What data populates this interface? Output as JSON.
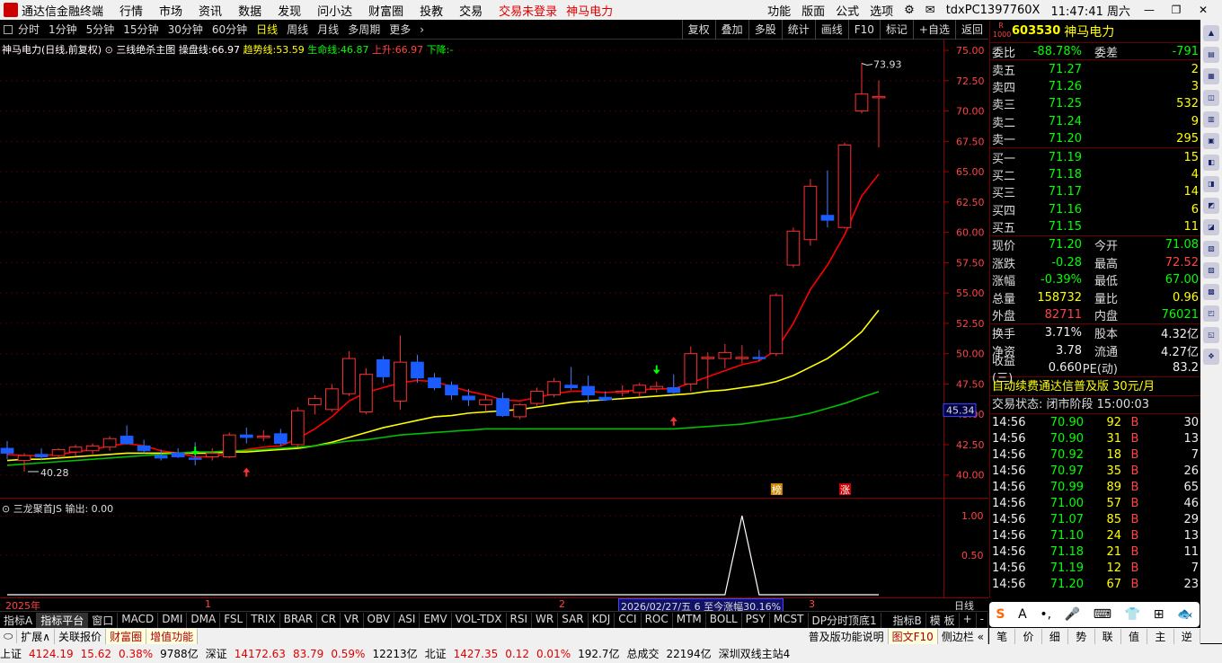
{
  "menubar": {
    "app_title": "通达信金融终端",
    "items": [
      "行情",
      "市场",
      "资讯",
      "数据",
      "发现",
      "问小达",
      "财富圈",
      "投教",
      "交易"
    ],
    "trade_status": "交易未登录",
    "stock_name": "神马电力",
    "right_items": [
      "功能",
      "版面",
      "公式",
      "选项"
    ],
    "machine": "tdxPC1397760X",
    "clock": "11:47:41 周六"
  },
  "periodbar": {
    "items": [
      "分时",
      "1分钟",
      "5分钟",
      "15分钟",
      "30分钟",
      "60分钟",
      "日线",
      "周线",
      "月线",
      "多周期",
      "更多"
    ],
    "active": "日线",
    "tools": [
      "复权",
      "叠加",
      "多股",
      "统计",
      "画线",
      "F10",
      "标记",
      "+自选",
      "返回"
    ]
  },
  "indicator_line": {
    "stock": "神马电力",
    "mode": "(日线,前复权)",
    "name": "三线绝杀主图",
    "cp_label": "操盘线:",
    "cp_value": "66.97",
    "qs_label": "趋势线:",
    "qs_value": "53.59",
    "sm_label": "生命线:",
    "sm_value": "46.87",
    "up_label": "上升:",
    "up_value": "66.97",
    "down_label": "下降:",
    "down_value": "-"
  },
  "sub_indicator": {
    "name": "三龙聚首JS",
    "out_label": "输出:",
    "out_value": "0.00"
  },
  "chart_data": {
    "type": "candlestick",
    "price_axis_ticks": [
      75.0,
      72.5,
      70.0,
      67.5,
      65.0,
      62.5,
      60.0,
      57.5,
      55.0,
      52.5,
      50.0,
      47.5,
      45.0,
      42.5,
      40.0
    ],
    "ylim": [
      38.5,
      75.3
    ],
    "current_price_label": "45.34",
    "high_annotation": "73.93",
    "low_annotation": "40.28",
    "sub_axis_ticks": [
      "1.00",
      "0.50"
    ],
    "time_labels": [
      "2025年",
      "1",
      "2",
      "3"
    ],
    "range_label": "2026/02/27/五 6 至今涨幅30.16%",
    "axis_unit": "日线",
    "tags": [
      "榜",
      "涨"
    ],
    "candles": [
      {
        "o": 42.2,
        "h": 42.8,
        "l": 41.3,
        "c": 41.8
      },
      {
        "o": 41.2,
        "h": 41.8,
        "l": 40.28,
        "c": 41.6
      },
      {
        "o": 41.7,
        "h": 42.2,
        "l": 41.2,
        "c": 41.5
      },
      {
        "o": 41.6,
        "h": 42.2,
        "l": 41.4,
        "c": 42.1
      },
      {
        "o": 41.9,
        "h": 42.5,
        "l": 41.6,
        "c": 42.3
      },
      {
        "o": 42.0,
        "h": 42.6,
        "l": 41.7,
        "c": 42.4
      },
      {
        "o": 42.3,
        "h": 43.2,
        "l": 42.0,
        "c": 43.0
      },
      {
        "o": 43.2,
        "h": 44.1,
        "l": 42.5,
        "c": 42.6
      },
      {
        "o": 42.4,
        "h": 42.9,
        "l": 41.8,
        "c": 42.0
      },
      {
        "o": 41.6,
        "h": 42.1,
        "l": 41.2,
        "c": 41.4
      },
      {
        "o": 41.8,
        "h": 42.2,
        "l": 41.4,
        "c": 41.5
      },
      {
        "o": 41.4,
        "h": 42.7,
        "l": 40.8,
        "c": 41.3
      },
      {
        "o": 41.5,
        "h": 42.2,
        "l": 41.2,
        "c": 41.8
      },
      {
        "o": 41.5,
        "h": 43.5,
        "l": 41.4,
        "c": 43.3
      },
      {
        "o": 43.3,
        "h": 43.9,
        "l": 42.6,
        "c": 43.1
      },
      {
        "o": 43.2,
        "h": 43.7,
        "l": 42.8,
        "c": 43.2
      },
      {
        "o": 43.4,
        "h": 43.8,
        "l": 42.4,
        "c": 42.6
      },
      {
        "o": 42.5,
        "h": 45.6,
        "l": 42.3,
        "c": 45.3
      },
      {
        "o": 45.8,
        "h": 46.6,
        "l": 45.0,
        "c": 46.3
      },
      {
        "o": 45.4,
        "h": 47.5,
        "l": 45.2,
        "c": 47.1
      },
      {
        "o": 46.7,
        "h": 50.2,
        "l": 46.5,
        "c": 49.6
      },
      {
        "o": 45.2,
        "h": 48.8,
        "l": 45.0,
        "c": 48.3
      },
      {
        "o": 49.5,
        "h": 49.8,
        "l": 47.6,
        "c": 48.1
      },
      {
        "o": 46.1,
        "h": 51.5,
        "l": 45.4,
        "c": 49.3
      },
      {
        "o": 49.3,
        "h": 49.9,
        "l": 47.6,
        "c": 48.0
      },
      {
        "o": 48.0,
        "h": 48.4,
        "l": 47.0,
        "c": 47.2
      },
      {
        "o": 47.4,
        "h": 47.7,
        "l": 46.2,
        "c": 46.6
      },
      {
        "o": 46.5,
        "h": 47.1,
        "l": 45.7,
        "c": 46.2
      },
      {
        "o": 45.8,
        "h": 46.6,
        "l": 45.3,
        "c": 46.2
      },
      {
        "o": 46.3,
        "h": 46.8,
        "l": 44.8,
        "c": 44.9
      },
      {
        "o": 44.8,
        "h": 45.9,
        "l": 44.6,
        "c": 45.8
      },
      {
        "o": 45.9,
        "h": 47.2,
        "l": 45.7,
        "c": 46.9
      },
      {
        "o": 46.6,
        "h": 48.0,
        "l": 46.4,
        "c": 47.7
      },
      {
        "o": 47.4,
        "h": 48.9,
        "l": 47.0,
        "c": 47.2
      },
      {
        "o": 47.3,
        "h": 48.2,
        "l": 45.9,
        "c": 46.6
      },
      {
        "o": 46.4,
        "h": 46.9,
        "l": 46.1,
        "c": 46.2
      },
      {
        "o": 46.8,
        "h": 47.4,
        "l": 46.5,
        "c": 46.9
      },
      {
        "o": 46.8,
        "h": 47.6,
        "l": 46.4,
        "c": 47.4
      },
      {
        "o": 47.1,
        "h": 47.7,
        "l": 46.8,
        "c": 47.3
      },
      {
        "o": 47.2,
        "h": 48.3,
        "l": 46.7,
        "c": 46.8
      },
      {
        "o": 47.5,
        "h": 50.6,
        "l": 46.9,
        "c": 50.0
      },
      {
        "o": 49.7,
        "h": 50.1,
        "l": 47.1,
        "c": 49.7
      },
      {
        "o": 49.6,
        "h": 50.8,
        "l": 48.8,
        "c": 50.1
      },
      {
        "o": 49.7,
        "h": 50.7,
        "l": 49.2,
        "c": 49.7
      },
      {
        "o": 49.7,
        "h": 50.3,
        "l": 49.4,
        "c": 49.6
      },
      {
        "o": 50.0,
        "h": 55.0,
        "l": 49.8,
        "c": 54.8
      },
      {
        "o": 57.3,
        "h": 60.4,
        "l": 57.1,
        "c": 60.1
      },
      {
        "o": 59.4,
        "h": 64.4,
        "l": 58.9,
        "c": 63.8
      },
      {
        "o": 61.4,
        "h": 65.1,
        "l": 60.4,
        "c": 61.0
      },
      {
        "o": 60.4,
        "h": 67.4,
        "l": 60.3,
        "c": 67.2
      },
      {
        "o": 70.0,
        "h": 73.93,
        "l": 69.8,
        "c": 71.4
      },
      {
        "o": 71.2,
        "h": 72.52,
        "l": 67.0,
        "c": 71.2
      }
    ],
    "series": [
      {
        "name": "操盘线",
        "color": "#ff0000",
        "values": [
          41.7,
          41.6,
          41.6,
          41.7,
          41.9,
          42.1,
          42.4,
          42.6,
          42.4,
          42.0,
          41.8,
          41.5,
          41.5,
          41.8,
          42.1,
          42.3,
          42.4,
          43.0,
          43.8,
          44.8,
          46.1,
          46.8,
          47.2,
          47.6,
          47.8,
          47.7,
          47.3,
          46.9,
          46.6,
          46.2,
          46.1,
          46.4,
          46.7,
          46.9,
          46.9,
          46.8,
          46.9,
          47.0,
          47.1,
          47.1,
          47.6,
          48.1,
          48.6,
          49.1,
          49.4,
          50.3,
          52.5,
          55.3,
          57.3,
          59.8,
          63.0,
          64.8
        ]
      },
      {
        "name": "趋势线",
        "color": "#ffff00",
        "values": [
          41.2,
          41.3,
          41.3,
          41.4,
          41.5,
          41.6,
          41.7,
          41.8,
          41.8,
          41.8,
          41.8,
          41.8,
          41.8,
          41.9,
          41.9,
          42.0,
          42.1,
          42.2,
          42.4,
          42.7,
          43.1,
          43.5,
          43.9,
          44.2,
          44.5,
          44.8,
          44.9,
          45.1,
          45.2,
          45.3,
          45.4,
          45.6,
          45.8,
          46.0,
          46.1,
          46.2,
          46.3,
          46.4,
          46.5,
          46.6,
          46.7,
          46.9,
          47.0,
          47.2,
          47.4,
          47.7,
          48.2,
          48.9,
          49.6,
          50.6,
          51.8,
          53.59
        ]
      },
      {
        "name": "生命线",
        "color": "#00c000",
        "values": [
          40.8,
          40.9,
          41.0,
          41.1,
          41.2,
          41.3,
          41.4,
          41.5,
          41.6,
          41.7,
          41.8,
          41.9,
          41.9,
          42.0,
          42.0,
          42.1,
          42.2,
          42.3,
          42.4,
          42.6,
          42.8,
          42.9,
          43.1,
          43.3,
          43.4,
          43.5,
          43.6,
          43.7,
          43.8,
          43.8,
          43.8,
          43.8,
          43.8,
          43.8,
          43.8,
          43.8,
          43.8,
          43.8,
          43.8,
          43.8,
          43.9,
          44.0,
          44.1,
          44.2,
          44.4,
          44.6,
          44.8,
          45.1,
          45.5,
          45.9,
          46.4,
          46.87
        ]
      }
    ],
    "sub_series": {
      "name": "三龙聚首JS",
      "peak_index": 43,
      "peak_value": 1.0
    }
  },
  "quote": {
    "badge": "R 1000",
    "code": "603530",
    "name": "神马电力",
    "wb_label": "委比",
    "wb_value": "-88.78%",
    "wc_label": "委差",
    "wc_value": "-791",
    "asks": [
      {
        "label": "卖五",
        "price": "71.27",
        "vol": "2"
      },
      {
        "label": "卖四",
        "price": "71.26",
        "vol": "3"
      },
      {
        "label": "卖三",
        "price": "71.25",
        "vol": "532"
      },
      {
        "label": "卖二",
        "price": "71.24",
        "vol": "9"
      },
      {
        "label": "卖一",
        "price": "71.20",
        "vol": "295"
      }
    ],
    "bids": [
      {
        "label": "买一",
        "price": "71.19",
        "vol": "15"
      },
      {
        "label": "买二",
        "price": "71.18",
        "vol": "4"
      },
      {
        "label": "买三",
        "price": "71.17",
        "vol": "14"
      },
      {
        "label": "买四",
        "price": "71.16",
        "vol": "6"
      },
      {
        "label": "买五",
        "price": "71.15",
        "vol": "11"
      }
    ],
    "stats1": [
      {
        "l1": "现价",
        "v1": "71.20",
        "l2": "今开",
        "v2": "71.08",
        "c1": "green",
        "c2": "green"
      },
      {
        "l1": "涨跌",
        "v1": "-0.28",
        "l2": "最高",
        "v2": "72.52",
        "c1": "green",
        "c2": "red"
      },
      {
        "l1": "涨幅",
        "v1": "-0.39%",
        "l2": "最低",
        "v2": "67.00",
        "c1": "green",
        "c2": "green"
      },
      {
        "l1": "总量",
        "v1": "158732",
        "l2": "量比",
        "v2": "0.96",
        "c1": "yellow",
        "c2": "yellow"
      },
      {
        "l1": "外盘",
        "v1": "82711",
        "l2": "内盘",
        "v2": "76021",
        "c1": "red",
        "c2": "green"
      }
    ],
    "stats2": [
      {
        "l1": "换手",
        "v1": "3.71%",
        "l2": "股本",
        "v2": "4.32亿",
        "c1": "white",
        "c2": "white"
      },
      {
        "l1": "净资",
        "v1": "3.78",
        "l2": "流通",
        "v2": "4.27亿",
        "c1": "white",
        "c2": "white"
      },
      {
        "l1": "收益(三)",
        "v1": "0.660",
        "l2": "PE(动)",
        "v2": "83.2",
        "c1": "white",
        "c2": "white"
      }
    ],
    "ad": "自动续费通达信普及版",
    "ad_price": "30元/月",
    "state": "交易状态: 闭市阶段 15:00:03",
    "ticks": [
      {
        "t": "14:56",
        "p": "70.90",
        "v": "92",
        "bs": "B",
        "n": "30"
      },
      {
        "t": "14:56",
        "p": "70.90",
        "v": "31",
        "bs": "B",
        "n": "13"
      },
      {
        "t": "14:56",
        "p": "70.92",
        "v": "18",
        "bs": "B",
        "n": "7"
      },
      {
        "t": "14:56",
        "p": "70.97",
        "v": "35",
        "bs": "B",
        "n": "26"
      },
      {
        "t": "14:56",
        "p": "70.99",
        "v": "89",
        "bs": "B",
        "n": "65"
      },
      {
        "t": "14:56",
        "p": "71.00",
        "v": "57",
        "bs": "B",
        "n": "46"
      },
      {
        "t": "14:56",
        "p": "71.07",
        "v": "85",
        "bs": "B",
        "n": "29"
      },
      {
        "t": "14:56",
        "p": "71.10",
        "v": "24",
        "bs": "B",
        "n": "13"
      },
      {
        "t": "14:56",
        "p": "71.18",
        "v": "21",
        "bs": "B",
        "n": "11"
      },
      {
        "t": "14:56",
        "p": "71.19",
        "v": "12",
        "bs": "B",
        "n": "7"
      },
      {
        "t": "14:56",
        "p": "71.20",
        "v": "67",
        "bs": "B",
        "n": "23"
      }
    ]
  },
  "tabbar": {
    "items": [
      "指标A",
      "指标平台",
      "窗口",
      "MACD",
      "DMI",
      "DMA",
      "FSL",
      "TRIX",
      "BRAR",
      "CR",
      "VR",
      "OBV",
      "ASI",
      "EMV",
      "VOL-TDX",
      "RSI",
      "WR",
      "SAR",
      "KDJ",
      "CCI",
      "ROC",
      "MTM",
      "BOLL",
      "PSY",
      "MCST",
      "DP分时顶底1"
    ],
    "selected": "指标平台",
    "right": [
      "指标B",
      "模 板",
      "+",
      "-"
    ]
  },
  "funcbar": {
    "items": [
      "扩展∧",
      "关联报价",
      "财富圈",
      "增值功能"
    ],
    "right": [
      "普及版功能说明",
      "图文F10",
      "侧边栏 «"
    ]
  },
  "ime": {
    "items": [
      "S",
      "A",
      "•,",
      "🎤",
      "⌨",
      "👕",
      "⊞",
      "🐟"
    ]
  },
  "bigmenu": {
    "items": [
      "笔",
      "价",
      "细",
      "势",
      "联",
      "值",
      "主",
      "逆"
    ]
  },
  "statusbar": [
    {
      "t": "上证",
      "c": ""
    },
    {
      "t": "4124.19",
      "c": "red"
    },
    {
      "t": "15.62",
      "c": "red"
    },
    {
      "t": "0.38%",
      "c": "red"
    },
    {
      "t": "9788亿",
      "c": ""
    },
    {
      "t": "深证",
      "c": ""
    },
    {
      "t": "14172.63",
      "c": "red"
    },
    {
      "t": "83.79",
      "c": "red"
    },
    {
      "t": "0.59%",
      "c": "red"
    },
    {
      "t": "12213亿",
      "c": ""
    },
    {
      "t": "北证",
      "c": ""
    },
    {
      "t": "1427.35",
      "c": "red"
    },
    {
      "t": "0.12",
      "c": "red"
    },
    {
      "t": "0.01%",
      "c": "red"
    },
    {
      "t": "192.7亿",
      "c": ""
    },
    {
      "t": "总成交",
      "c": ""
    },
    {
      "t": "22194亿",
      "c": ""
    },
    {
      "t": "深圳双线主站4",
      "c": ""
    }
  ]
}
